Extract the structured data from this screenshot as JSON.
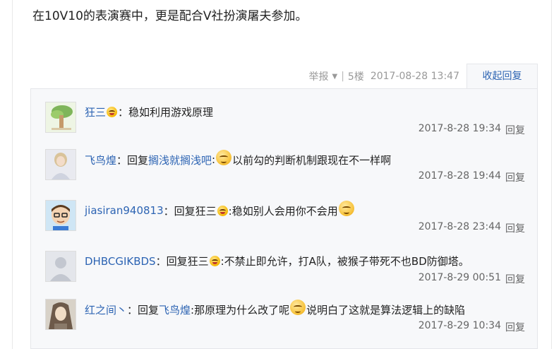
{
  "post": {
    "text": "在10V10的表演赛中，更是配合V社扮演屠夫参加。",
    "report_label": "举报",
    "floor": "5楼",
    "timestamp": "2017-08-28 13:47",
    "collapse_label": "收起回复",
    "separator": "|"
  },
  "replies": [
    {
      "user": "狂三",
      "parts": [
        "：稳如利用游戏原理"
      ],
      "time": "2017-8-28 19:34",
      "reply_label": "回复"
    },
    {
      "user": "飞鸟煌",
      "parts": [
        "：回复 ",
        "搁浅就搁浅吧",
        " :",
        "以前勾的判断机制跟现在不一样啊"
      ],
      "time": "2017-8-28 19:44",
      "reply_label": "回复"
    },
    {
      "user": "jiasiran940813",
      "parts": [
        "：回复 ",
        "狂三",
        " :稳如别人会用你不会用"
      ],
      "time": "2017-8-28 23:44",
      "reply_label": "回复"
    },
    {
      "user": "DHBCGIKBDS",
      "parts": [
        "：回复 ",
        "狂三",
        " :不禁止即允许，打A队，被猴子带死不也BD防御塔。"
      ],
      "time": "2017-8-29 00:51",
      "reply_label": "回复"
    },
    {
      "user": "红之间丶",
      "parts": [
        "：回复 ",
        "飞鸟煌",
        " :那原理为什么改了呢",
        "说明白了这就是算法逻辑上的缺陷"
      ],
      "time": "2017-8-29 10:34",
      "reply_label": "回复"
    }
  ],
  "colors": {
    "link": "#2d64b3",
    "box_bg": "#f7f8fa",
    "meta": "#999999"
  },
  "icons": {
    "emoji": "laughing-face-emoji",
    "caret": "caret-down-icon"
  }
}
